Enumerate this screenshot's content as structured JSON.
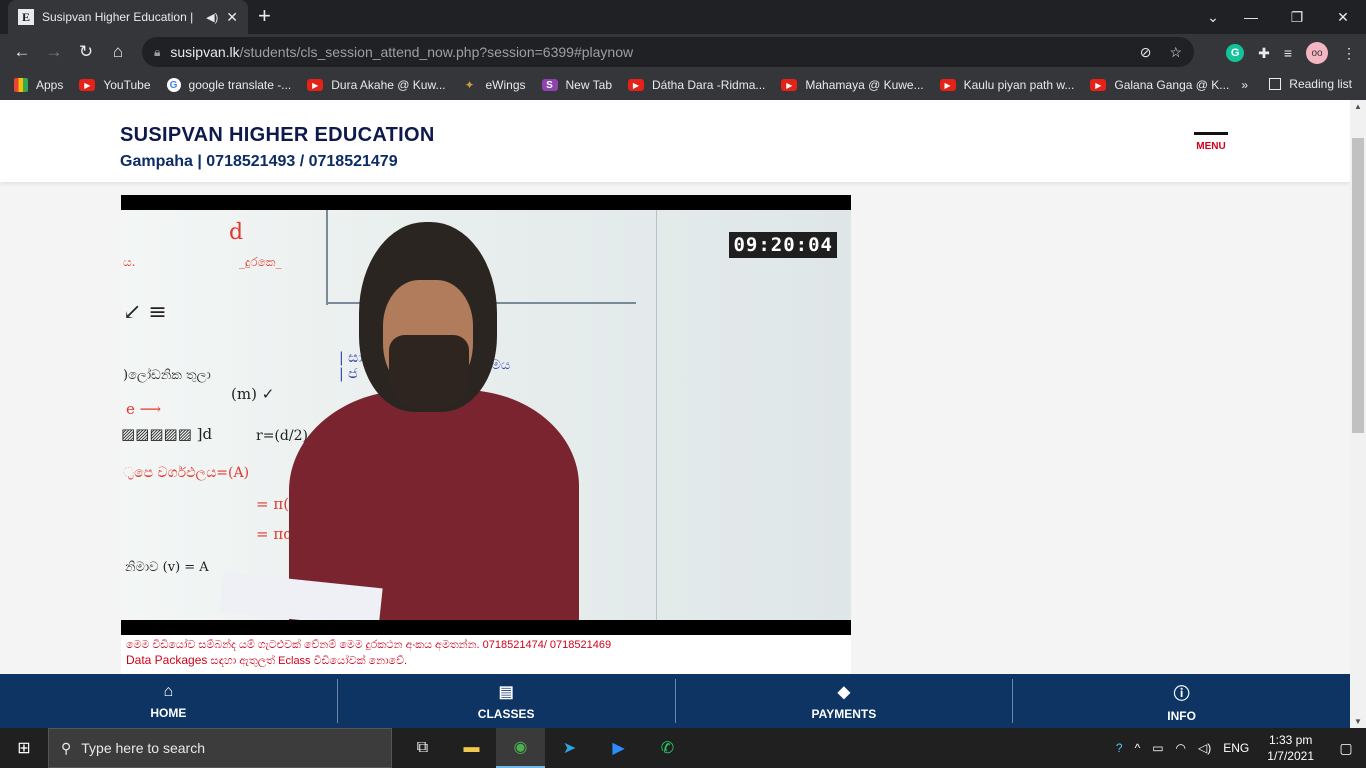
{
  "browser": {
    "tab_title": "Susipvan Higher Education |",
    "tab_favicon": "E",
    "url_host": "susipvan.lk",
    "url_path": "/students/cls_session_attend_now.php?session=6399#playnow",
    "bookmarks": [
      {
        "label": "Apps",
        "icon": "apps"
      },
      {
        "label": "YouTube",
        "icon": "yt"
      },
      {
        "label": "google translate -...",
        "icon": "goog"
      },
      {
        "label": "Dura Akahe @ Kuw...",
        "icon": "yt"
      },
      {
        "label": "eWings",
        "icon": "wing"
      },
      {
        "label": "New Tab",
        "icon": "s"
      },
      {
        "label": "Dátha Dara -Ridma...",
        "icon": "yt"
      },
      {
        "label": "Mahamaya @ Kuwe...",
        "icon": "yt"
      },
      {
        "label": "Kaulu piyan path w...",
        "icon": "yt"
      },
      {
        "label": "Galana Ganga @ K...",
        "icon": "yt"
      }
    ],
    "bookmarks_more": "»",
    "reading_list": "Reading list"
  },
  "site": {
    "brand": "SUSIPVAN HIGHER EDUCATION",
    "contact": "Gampaha | 0718521493 / 0718521479",
    "menu_label": "MENU"
  },
  "video": {
    "timer": "09:20:04",
    "caption_line1": "මෙම වීඩියෝව සම්බන්ද යම් ගැටළුවක් වේනම් මෙම දුරකථන අංකය අමතන්න. 0718521474/ 0718521469",
    "caption_line2_highlight": "Data Packages",
    "caption_line2_rest": " සඳහා ඇතුලත් Eclass වීඩියෝවක් නොවේ."
  },
  "bottom_nav": [
    {
      "label": "HOME",
      "icon": "home-icon"
    },
    {
      "label": "CLASSES",
      "icon": "classes-icon"
    },
    {
      "label": "PAYMENTS",
      "icon": "tag-icon"
    },
    {
      "label": "INFO",
      "icon": "info-icon"
    }
  ],
  "taskbar": {
    "search_placeholder": "Type here to search",
    "lang": "ENG",
    "time": "1:33 pm",
    "date": "1/7/2021"
  }
}
